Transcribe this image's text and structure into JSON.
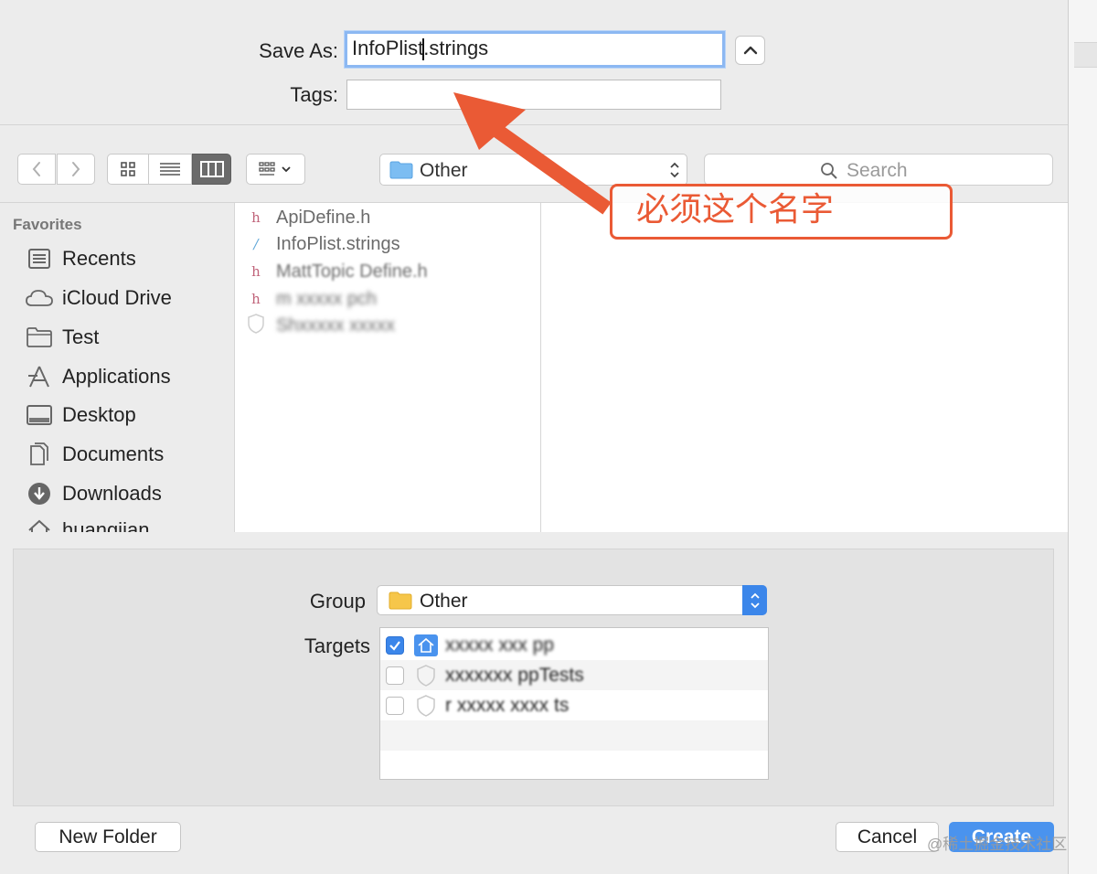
{
  "save_as": {
    "label": "Save As:",
    "value_before_caret": "InfoPlist",
    "value_after_caret": ".strings"
  },
  "tags": {
    "label": "Tags:",
    "value": ""
  },
  "toolbar": {
    "location": "Other",
    "search_placeholder": "Search"
  },
  "sidebar": {
    "heading": "Favorites",
    "items": [
      {
        "label": "Recents",
        "icon": "recents-icon"
      },
      {
        "label": "iCloud Drive",
        "icon": "cloud-icon"
      },
      {
        "label": "Test",
        "icon": "folder-icon"
      },
      {
        "label": "Applications",
        "icon": "applications-icon"
      },
      {
        "label": "Desktop",
        "icon": "desktop-icon"
      },
      {
        "label": "Documents",
        "icon": "documents-icon"
      },
      {
        "label": "Downloads",
        "icon": "downloads-icon"
      },
      {
        "label": "huangjian",
        "icon": "home-icon"
      }
    ]
  },
  "files": [
    {
      "name": "ApiDefine.h",
      "icon": "h"
    },
    {
      "name": "InfoPlist.strings",
      "icon": "/"
    },
    {
      "name": "MattTopic Define.h",
      "icon": "h"
    },
    {
      "name": "m xxxxx pch",
      "icon": "h"
    },
    {
      "name": "Shxxxxx xxxxx",
      "icon": ""
    }
  ],
  "options": {
    "group_label": "Group",
    "group_value": "Other",
    "targets_label": "Targets",
    "targets": [
      {
        "name": "xxxxx xxx pp",
        "checked": true
      },
      {
        "name": "xxxxxxx ppTests",
        "checked": false
      },
      {
        "name": "r xxxxx xxxx ts",
        "checked": false
      }
    ]
  },
  "buttons": {
    "new_folder": "New Folder",
    "cancel": "Cancel",
    "create": "Create"
  },
  "annotation": {
    "text": "必须这个名字",
    "color": "#ea5a35"
  },
  "watermark": "@稀土掘金技术社区",
  "colors": {
    "accent": "#3b86ea",
    "annotation": "#ea5a35"
  }
}
